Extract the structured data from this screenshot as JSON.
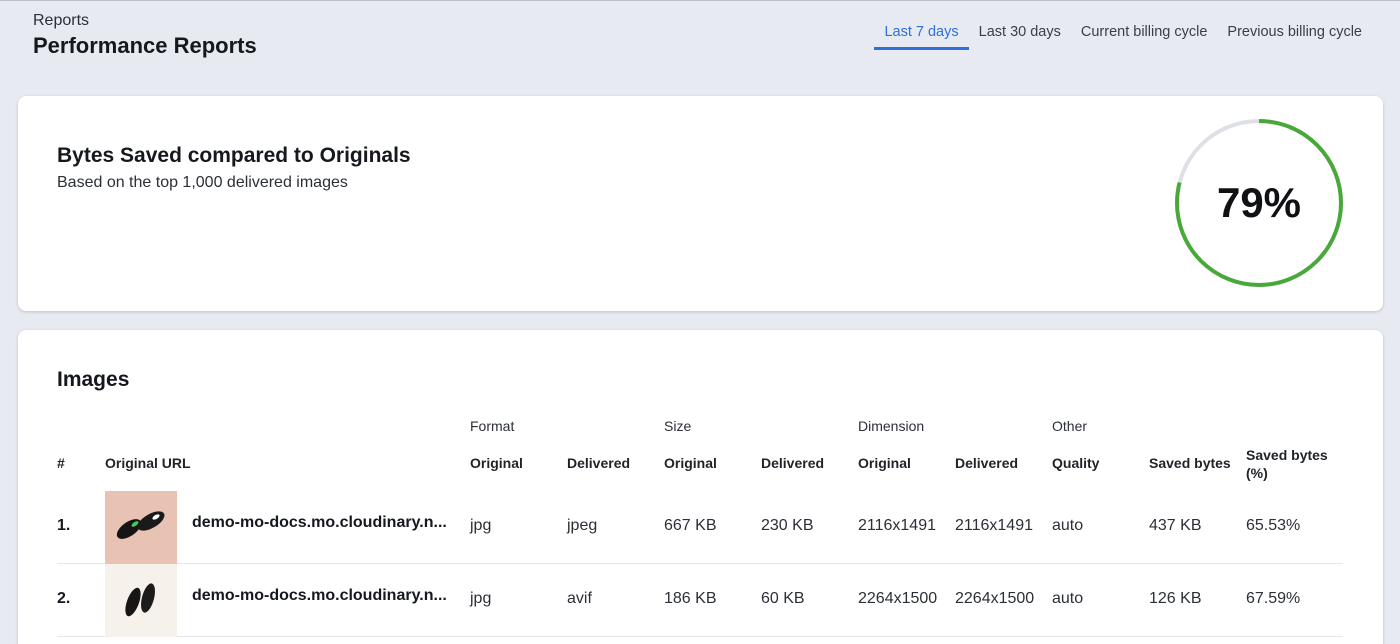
{
  "header": {
    "breadcrumb": "Reports",
    "title": "Performance Reports"
  },
  "tabs": [
    {
      "label": "Last 7 days",
      "active": true
    },
    {
      "label": "Last 30 days",
      "active": false
    },
    {
      "label": "Current billing cycle",
      "active": false
    },
    {
      "label": "Previous billing cycle",
      "active": false
    }
  ],
  "bytes_saved": {
    "title": "Bytes Saved compared to Originals",
    "subtitle": "Based on the top 1,000 delivered images",
    "percent_label": "79%",
    "percent_value": 79,
    "gauge_color": "#4aa83a",
    "track_color": "#dde1e6"
  },
  "images": {
    "title": "Images",
    "group_headers": {
      "format": "Format",
      "size": "Size",
      "dimension": "Dimension",
      "other": "Other"
    },
    "columns": {
      "index": "#",
      "original_url": "Original URL",
      "format_original": "Original",
      "format_delivered": "Delivered",
      "size_original": "Original",
      "size_delivered": "Delivered",
      "dimension_original": "Original",
      "dimension_delivered": "Delivered",
      "quality": "Quality",
      "saved_bytes": "Saved bytes",
      "saved_bytes_pct": "Saved bytes (%)"
    },
    "rows": [
      {
        "index": "1.",
        "url": "demo-mo-docs.mo.cloudinary.n...",
        "thumbnail_icon": "sneakers-thumbnail",
        "format_original": "jpg",
        "format_delivered": "jpeg",
        "size_original": "667 KB",
        "size_delivered": "230 KB",
        "dimension_original": "2116x1491",
        "dimension_delivered": "2116x1491",
        "quality": "auto",
        "saved_bytes": "437 KB",
        "saved_bytes_pct": "65.53%"
      },
      {
        "index": "2.",
        "url": "demo-mo-docs.mo.cloudinary.n...",
        "thumbnail_icon": "sneakers-thumbnail",
        "format_original": "jpg",
        "format_delivered": "avif",
        "size_original": "186 KB",
        "size_delivered": "60 KB",
        "dimension_original": "2264x1500",
        "dimension_delivered": "2264x1500",
        "quality": "auto",
        "saved_bytes": "126 KB",
        "saved_bytes_pct": "67.59%"
      }
    ]
  }
}
